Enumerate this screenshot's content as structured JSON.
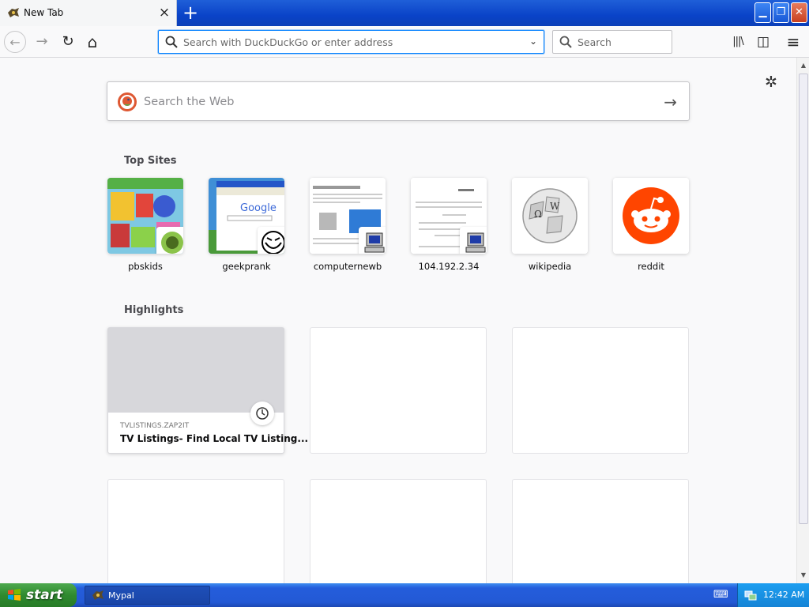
{
  "window": {
    "tab_title": "New Tab",
    "tab_close": "×",
    "new_tab": "+",
    "minimize": "▁",
    "restore": "❐",
    "close": "✕"
  },
  "toolbar": {
    "back": "←",
    "forward": "→",
    "reload": "↻",
    "home": "⌂",
    "url_placeholder": "Search with DuckDuckGo or enter address",
    "url_dropdown": "⌄",
    "search_placeholder": "Search",
    "library": "|||\\",
    "sidebar": "◫",
    "menu": "≡"
  },
  "content": {
    "settings_icon": "✲",
    "web_search_placeholder": "Search the Web",
    "web_search_go": "→",
    "top_sites_title": "Top Sites",
    "top_sites": [
      {
        "label": "pbskids",
        "icon": "pbs-kids-thumbnail"
      },
      {
        "label": "geekprank",
        "icon": "geekprank-thumbnail"
      },
      {
        "label": "computernewb",
        "icon": "computer-thumbnail"
      },
      {
        "label": "104.192.2.34",
        "icon": "computer-thumbnail"
      },
      {
        "label": "wikipedia",
        "icon": "wikipedia-globe-icon"
      },
      {
        "label": "reddit",
        "icon": "reddit-icon"
      }
    ],
    "highlights_title": "Highlights",
    "highlights": [
      {
        "source": "TVLISTINGS.ZAP2IT",
        "title": "TV Listings- Find Local TV Listing..."
      }
    ]
  },
  "taskbar": {
    "start_label": "start",
    "task_label": "Mypal",
    "clock": "12:42 AM"
  },
  "colors": {
    "accent": "#0a84ff",
    "reddit": "#ff4500",
    "duckduckgo": "#de5833",
    "xp_blue": "#245ddb",
    "xp_green": "#2f8a2f"
  }
}
